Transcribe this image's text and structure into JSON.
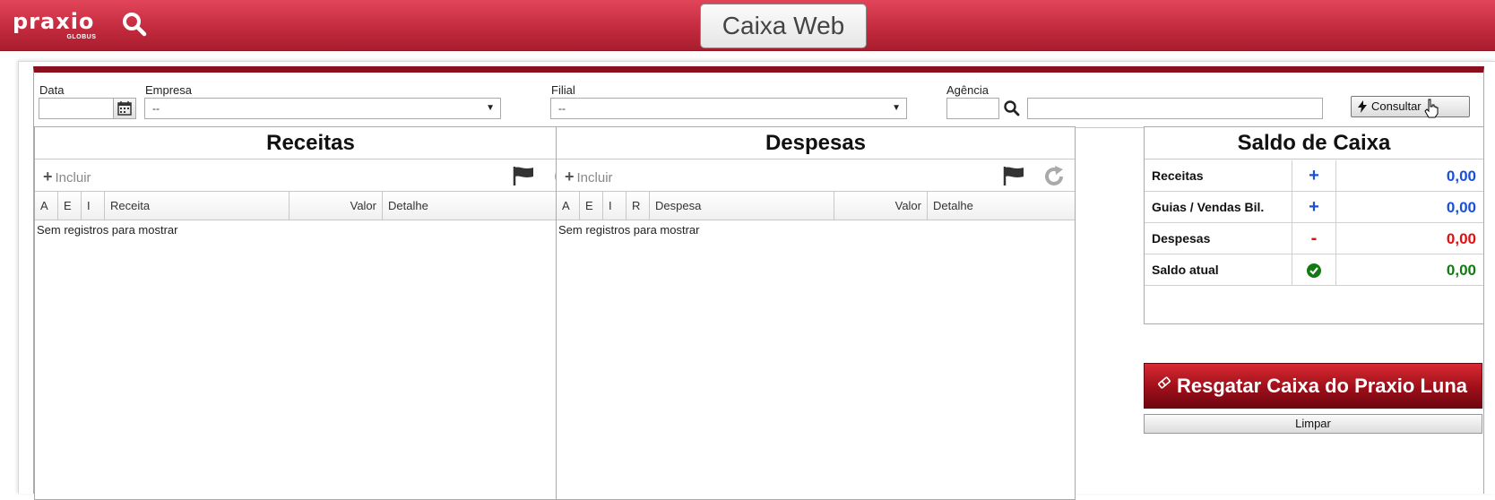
{
  "header": {
    "logo_main": "praxio",
    "logo_sub": "GLOBUS",
    "title": "Caixa Web"
  },
  "filters": {
    "data_label": "Data",
    "data_value": "",
    "empresa_label": "Empresa",
    "empresa_value": "--",
    "filial_label": "Filial",
    "filial_value": "--",
    "agencia_label": "Agência",
    "agencia_code": "",
    "agencia_name": "",
    "consultar_label": "Consultar"
  },
  "receitas": {
    "title": "Receitas",
    "incluir_label": "Incluir",
    "columns": [
      "A",
      "E",
      "I",
      "Receita",
      "Valor",
      "Detalhe"
    ],
    "empty_message": "Sem registros para mostrar"
  },
  "despesas": {
    "title": "Despesas",
    "incluir_label": "Incluir",
    "columns": [
      "A",
      "E",
      "I",
      "R",
      "Despesa",
      "Valor",
      "Detalhe"
    ],
    "empty_message": "Sem registros para mostrar"
  },
  "saldo": {
    "title": "Saldo de Caixa",
    "rows": [
      {
        "label": "Receitas",
        "sign": "+",
        "value": "0,00",
        "color": "#1a4fd6"
      },
      {
        "label": "Guias / Vendas Bil.",
        "sign": "+",
        "value": "0,00",
        "color": "#1a4fd6"
      },
      {
        "label": "Despesas",
        "sign": "-",
        "value": "0,00",
        "color": "#e01010"
      },
      {
        "label": "Saldo atual",
        "sign": "check-circle-icon",
        "value": "0,00",
        "color": "#137a13"
      }
    ]
  },
  "actions": {
    "resgatar_label": "Resgatar Caixa do Praxio Luna",
    "limpar_label": "Limpar"
  },
  "colors": {
    "header_red": "#c42b3e",
    "accent_dark_red": "#8a0f1f",
    "positive_blue": "#1a4fd6",
    "negative_red": "#e01010",
    "saldo_green": "#137a13"
  }
}
